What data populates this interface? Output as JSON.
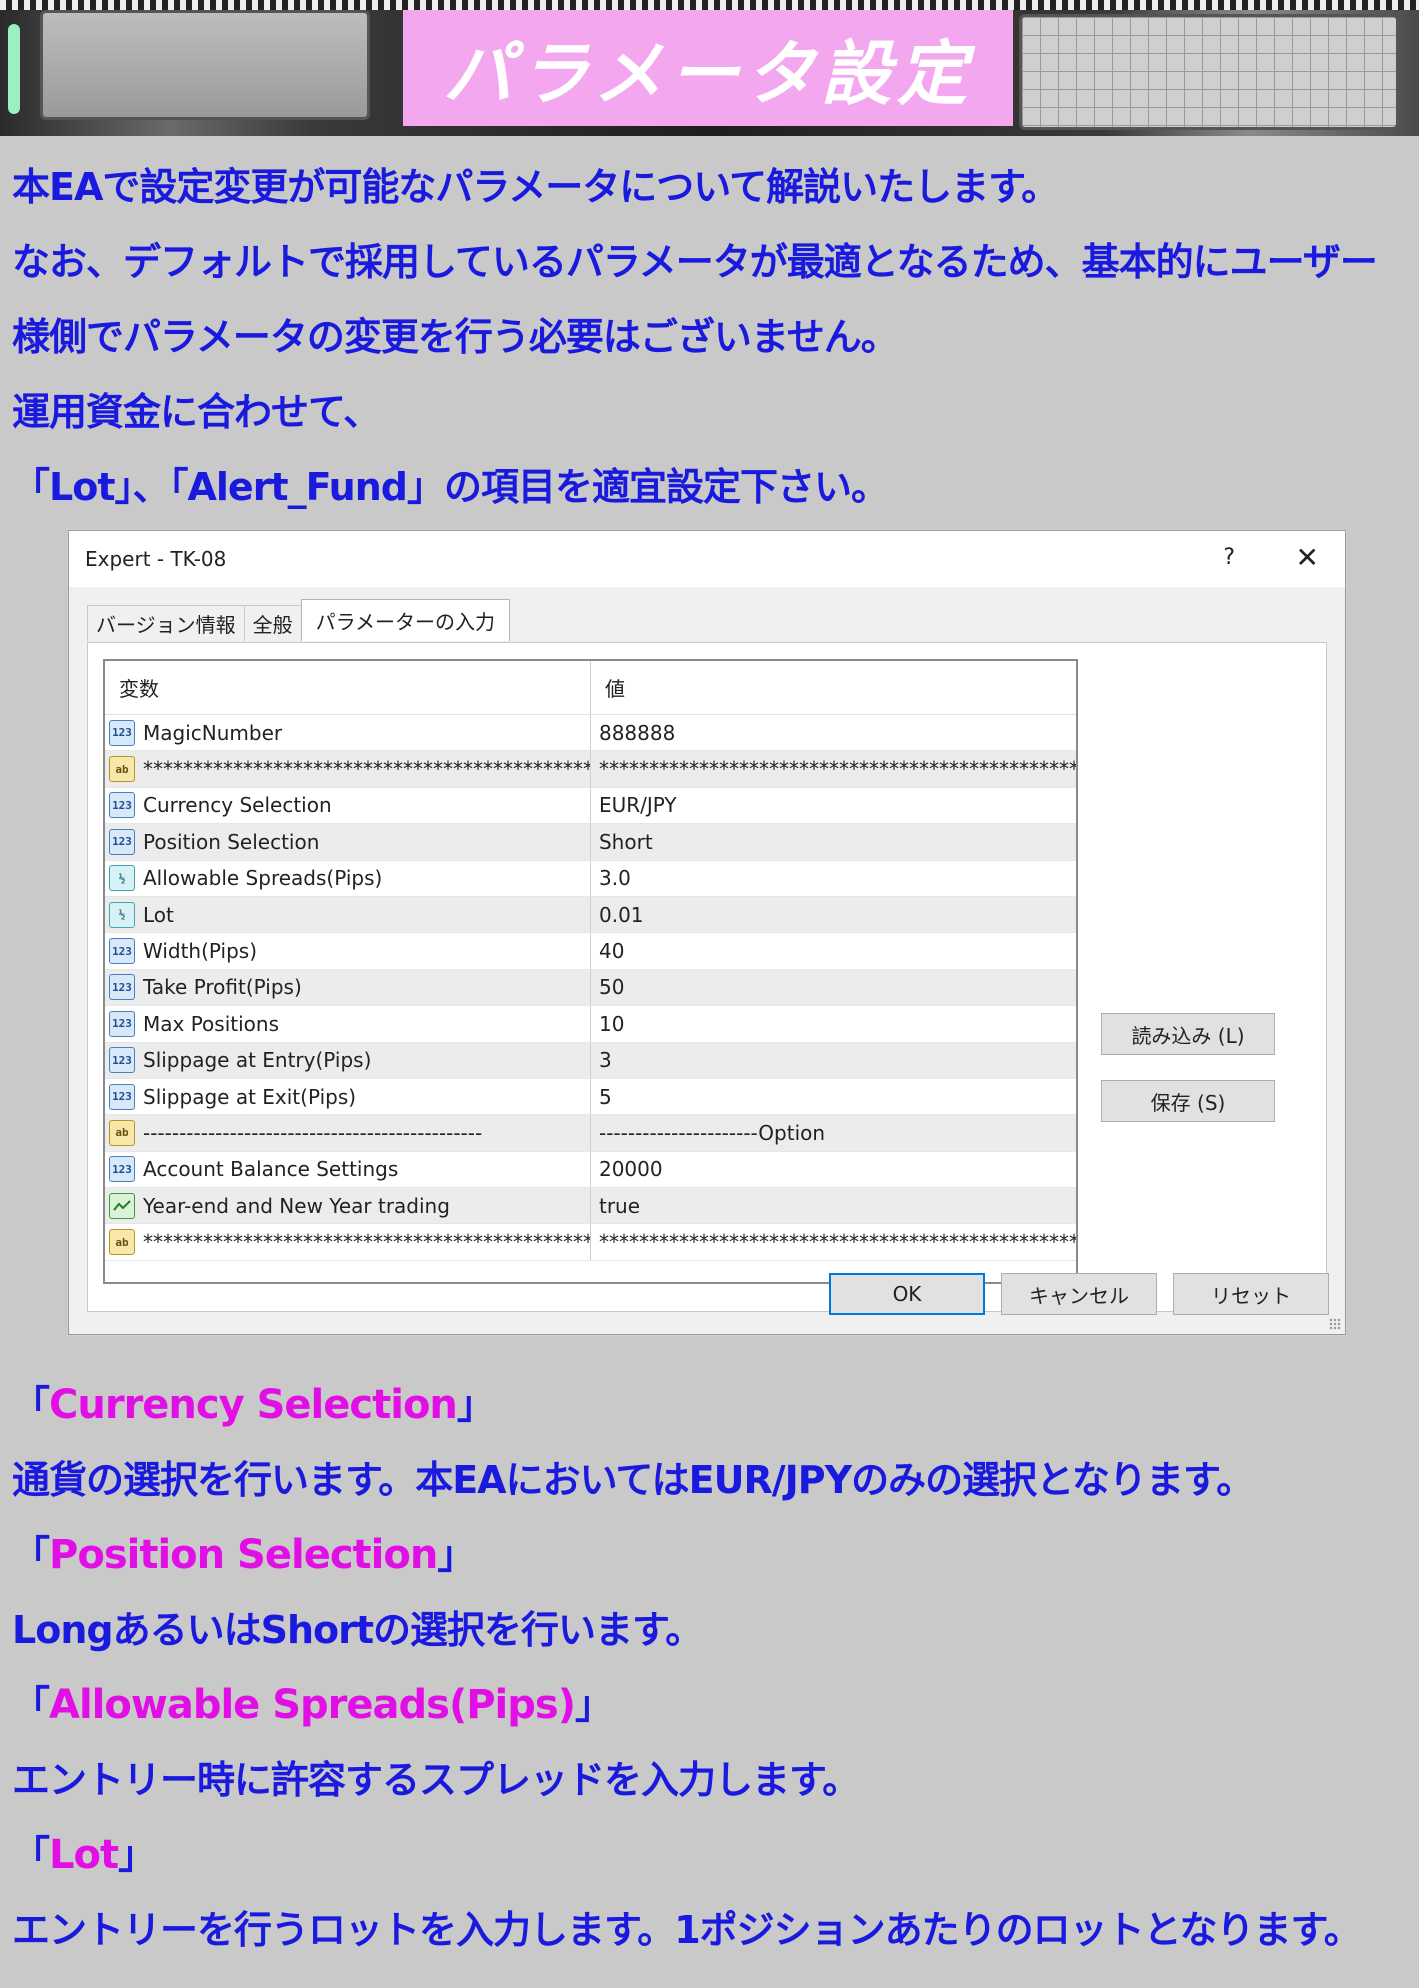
{
  "banner": {
    "title": "パラメータ設定"
  },
  "intro": [
    "本EAで設定変更が可能なパラメータについて解説いたします。",
    "なお、デフォルトで採用しているパラメータが最適となるため、基本的にユーザー",
    "様側でパラメータの変更を行う必要はございません。",
    "運用資金に合わせて、",
    "「Lot」、「Alert_Fund」の項目を適宜設定下さい。"
  ],
  "dialog": {
    "title": "Expert - TK-08",
    "help": "?",
    "close": "✕",
    "tabs": [
      "バージョン情報",
      "全般",
      "パラメーターの入力"
    ],
    "columns": {
      "variable": "変数",
      "value": "値"
    },
    "rows": [
      {
        "icon": "123",
        "name": "MagicNumber",
        "value": "888888"
      },
      {
        "icon": "ab",
        "name": "***********************************************",
        "value": "****************************************************"
      },
      {
        "icon": "123",
        "name": "Currency Selection",
        "value": "EUR/JPY"
      },
      {
        "icon": "123",
        "name": "Position Selection",
        "value": "Short"
      },
      {
        "icon": "½",
        "name": "Allowable Spreads(Pips)",
        "value": "3.0"
      },
      {
        "icon": "½",
        "name": "Lot",
        "value": "0.01"
      },
      {
        "icon": "123",
        "name": "Width(Pips)",
        "value": "40"
      },
      {
        "icon": "123",
        "name": "Take Profit(Pips)",
        "value": "50"
      },
      {
        "icon": "123",
        "name": "Max Positions",
        "value": "10"
      },
      {
        "icon": "123",
        "name": "Slippage at Entry(Pips)",
        "value": "3"
      },
      {
        "icon": "123",
        "name": "Slippage at Exit(Pips)",
        "value": "5"
      },
      {
        "icon": "ab",
        "name": "-----------------------------------------------",
        "value": "----------------------Option"
      },
      {
        "icon": "123",
        "name": "Account Balance Settings",
        "value": "20000"
      },
      {
        "icon": "bool",
        "name": "Year-end and New Year trading",
        "value": "true"
      },
      {
        "icon": "ab",
        "name": "***********************************************",
        "value": "****************************************************"
      }
    ],
    "buttons": {
      "load": "読み込み (L)",
      "save": "保存 (S)",
      "ok": "OK",
      "cancel": "キャンセル",
      "reset": "リセット"
    }
  },
  "notes": {
    "currency": {
      "head": "Currency Selection",
      "body": "通貨の選択を行います。本EAにおいてはEUR/JPYのみの選択となります。"
    },
    "position": {
      "head": "Position Selection",
      "body": "LongあるいはShortの選択を行います。"
    },
    "spread": {
      "head": "Allowable Spreads(Pips)",
      "body": "エントリー時に許容するスプレッドを入力します。"
    },
    "lot": {
      "head": "Lot",
      "body": "エントリーを行うロットを入力します。1ポジションあたりのロットとなります。"
    }
  }
}
